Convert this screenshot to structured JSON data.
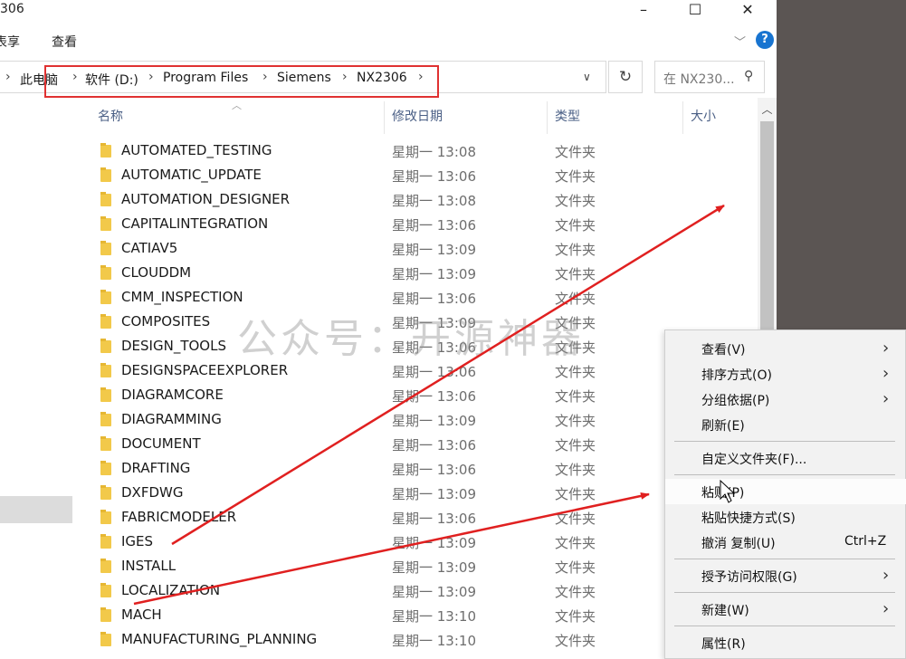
{
  "window": {
    "title": "306",
    "controls": {
      "minimize": "–",
      "maximize": "☐",
      "close": "✕"
    }
  },
  "ribbon": {
    "tabs": [
      "共享",
      "查看"
    ],
    "shown_tab_labels": [
      "表享",
      "查看"
    ],
    "help": "?"
  },
  "address": {
    "breadcrumbs": [
      "此电脑",
      "软件 (D:)",
      "Program Files",
      "Siemens",
      "NX2306"
    ],
    "search_placeholder": "在 NX230...",
    "highlight_color": "#e03131"
  },
  "columns": {
    "name": "名称",
    "date": "修改日期",
    "type": "类型",
    "size": "大小"
  },
  "files": [
    {
      "name": "AUTOMATED_TESTING",
      "date": "星期一 13:08",
      "type": "文件夹"
    },
    {
      "name": "AUTOMATIC_UPDATE",
      "date": "星期一 13:06",
      "type": "文件夹"
    },
    {
      "name": "AUTOMATION_DESIGNER",
      "date": "星期一 13:08",
      "type": "文件夹"
    },
    {
      "name": "CAPITALINTEGRATION",
      "date": "星期一 13:06",
      "type": "文件夹"
    },
    {
      "name": "CATIAV5",
      "date": "星期一 13:09",
      "type": "文件夹"
    },
    {
      "name": "CLOUDDM",
      "date": "星期一 13:09",
      "type": "文件夹"
    },
    {
      "name": "CMM_INSPECTION",
      "date": "星期一 13:06",
      "type": "文件夹"
    },
    {
      "name": "COMPOSITES",
      "date": "星期一 13:09",
      "type": "文件夹"
    },
    {
      "name": "DESIGN_TOOLS",
      "date": "星期一 13:06",
      "type": "文件夹"
    },
    {
      "name": "DESIGNSPACEEXPLORER",
      "date": "星期一 13:06",
      "type": "文件夹"
    },
    {
      "name": "DIAGRAMCORE",
      "date": "星期一 13:06",
      "type": "文件夹"
    },
    {
      "name": "DIAGRAMMING",
      "date": "星期一 13:09",
      "type": "文件夹"
    },
    {
      "name": "DOCUMENT",
      "date": "星期一 13:06",
      "type": "文件夹"
    },
    {
      "name": "DRAFTING",
      "date": "星期一 13:06",
      "type": "文件夹"
    },
    {
      "name": "DXFDWG",
      "date": "星期一 13:09",
      "type": "文件夹"
    },
    {
      "name": "FABRICMODELER",
      "date": "星期一 13:06",
      "type": "文件夹"
    },
    {
      "name": "IGES",
      "date": "星期一 13:09",
      "type": "文件夹"
    },
    {
      "name": "INSTALL",
      "date": "星期一 13:09",
      "type": "文件夹"
    },
    {
      "name": "LOCALIZATION",
      "date": "星期一 13:09",
      "type": "文件夹"
    },
    {
      "name": "MACH",
      "date": "星期一 13:10",
      "type": "文件夹"
    },
    {
      "name": "MANUFACTURING_PLANNING",
      "date": "星期一 13:10",
      "type": "文件夹"
    }
  ],
  "watermark": "公众号：开源神器",
  "context_menu": {
    "view": "查看(V)",
    "sort": "排序方式(O)",
    "group": "分组依据(P)",
    "refresh": "刷新(E)",
    "customize": "自定义文件夹(F)...",
    "paste": "粘贴(P)",
    "paste_shortcut": "粘贴快捷方式(S)",
    "undo": "撤消 复制(U)",
    "undo_shortcut": "Ctrl+Z",
    "grant_access": "授予访问权限(G)",
    "new": "新建(W)",
    "properties": "属性(R)"
  },
  "annotation_color": "#e02020"
}
